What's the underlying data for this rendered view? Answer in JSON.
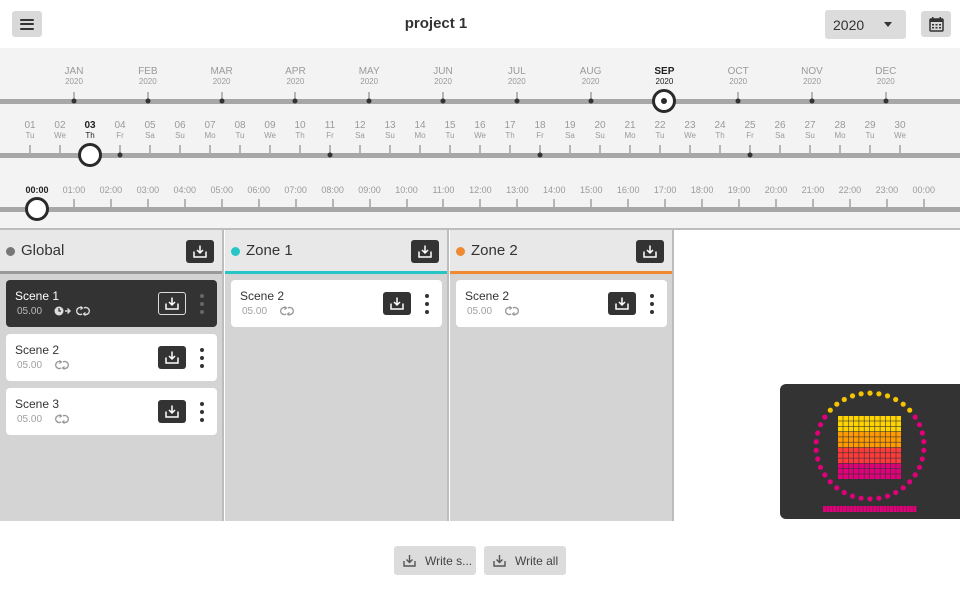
{
  "header": {
    "title": "project 1",
    "year": "2020",
    "menu_icon": "hamburger-menu-icon",
    "calendar_icon": "calendar-icon"
  },
  "timeline": {
    "months": [
      {
        "name": "JAN",
        "year": "2020"
      },
      {
        "name": "FEB",
        "year": "2020"
      },
      {
        "name": "MAR",
        "year": "2020"
      },
      {
        "name": "APR",
        "year": "2020"
      },
      {
        "name": "MAY",
        "year": "2020"
      },
      {
        "name": "JUN",
        "year": "2020"
      },
      {
        "name": "JUL",
        "year": "2020"
      },
      {
        "name": "AUG",
        "year": "2020"
      },
      {
        "name": "SEP",
        "year": "2020"
      },
      {
        "name": "OCT",
        "year": "2020"
      },
      {
        "name": "NOV",
        "year": "2020"
      },
      {
        "name": "DEC",
        "year": "2020"
      }
    ],
    "selected_month": "SEP",
    "days": [
      {
        "num": "01",
        "dow": "Tu"
      },
      {
        "num": "02",
        "dow": "We"
      },
      {
        "num": "03",
        "dow": "Th"
      },
      {
        "num": "04",
        "dow": "Fr"
      },
      {
        "num": "05",
        "dow": "Sa"
      },
      {
        "num": "06",
        "dow": "Su"
      },
      {
        "num": "07",
        "dow": "Mo"
      },
      {
        "num": "08",
        "dow": "Tu"
      },
      {
        "num": "09",
        "dow": "We"
      },
      {
        "num": "10",
        "dow": "Th"
      },
      {
        "num": "11",
        "dow": "Fr"
      },
      {
        "num": "12",
        "dow": "Sa"
      },
      {
        "num": "13",
        "dow": "Su"
      },
      {
        "num": "14",
        "dow": "Mo"
      },
      {
        "num": "15",
        "dow": "Tu"
      },
      {
        "num": "16",
        "dow": "We"
      },
      {
        "num": "17",
        "dow": "Th"
      },
      {
        "num": "18",
        "dow": "Fr"
      },
      {
        "num": "19",
        "dow": "Sa"
      },
      {
        "num": "20",
        "dow": "Su"
      },
      {
        "num": "21",
        "dow": "Mo"
      },
      {
        "num": "22",
        "dow": "Tu"
      },
      {
        "num": "23",
        "dow": "We"
      },
      {
        "num": "24",
        "dow": "Th"
      },
      {
        "num": "25",
        "dow": "Fr"
      },
      {
        "num": "26",
        "dow": "Sa"
      },
      {
        "num": "27",
        "dow": "Su"
      },
      {
        "num": "28",
        "dow": "Mo"
      },
      {
        "num": "29",
        "dow": "Tu"
      },
      {
        "num": "30",
        "dow": "We"
      }
    ],
    "selected_day": "03",
    "day_markers": [
      "04",
      "11",
      "18",
      "25"
    ],
    "hours": [
      "00:00",
      "01:00",
      "02:00",
      "03:00",
      "04:00",
      "05:00",
      "06:00",
      "07:00",
      "08:00",
      "09:00",
      "10:00",
      "11:00",
      "12:00",
      "13:00",
      "14:00",
      "15:00",
      "16:00",
      "17:00",
      "18:00",
      "19:00",
      "20:00",
      "21:00",
      "22:00",
      "23:00",
      "00:00"
    ],
    "selected_hour": "00:00"
  },
  "zones": [
    {
      "name": "Global",
      "color": "#777777",
      "scenes": [
        {
          "name": "Scene 1",
          "time": "05.00",
          "selected": true,
          "icons": [
            "clock-arrow-icon",
            "repeat-icon"
          ]
        },
        {
          "name": "Scene 2",
          "time": "05.00",
          "selected": false,
          "icons": [
            "repeat-icon"
          ]
        },
        {
          "name": "Scene 3",
          "time": "05.00",
          "selected": false,
          "icons": [
            "repeat-icon"
          ]
        }
      ]
    },
    {
      "name": "Zone 1",
      "color": "#26c6c6",
      "scenes": [
        {
          "name": "Scene 2",
          "time": "05.00",
          "selected": false,
          "icons": [
            "repeat-icon"
          ]
        }
      ]
    },
    {
      "name": "Zone 2",
      "color": "#f08a30",
      "scenes": [
        {
          "name": "Scene 2",
          "time": "05.00",
          "selected": false,
          "icons": [
            "repeat-icon"
          ]
        }
      ]
    }
  ],
  "preview": {
    "ring_colors": [
      "#f5c400",
      "#e0007a"
    ],
    "grid_colors": [
      "#ffd400",
      "#ff9a00",
      "#ff3a3a",
      "#e0007a"
    ]
  },
  "footer": {
    "write_selected_label": "Write s...",
    "write_all_label": "Write all"
  }
}
